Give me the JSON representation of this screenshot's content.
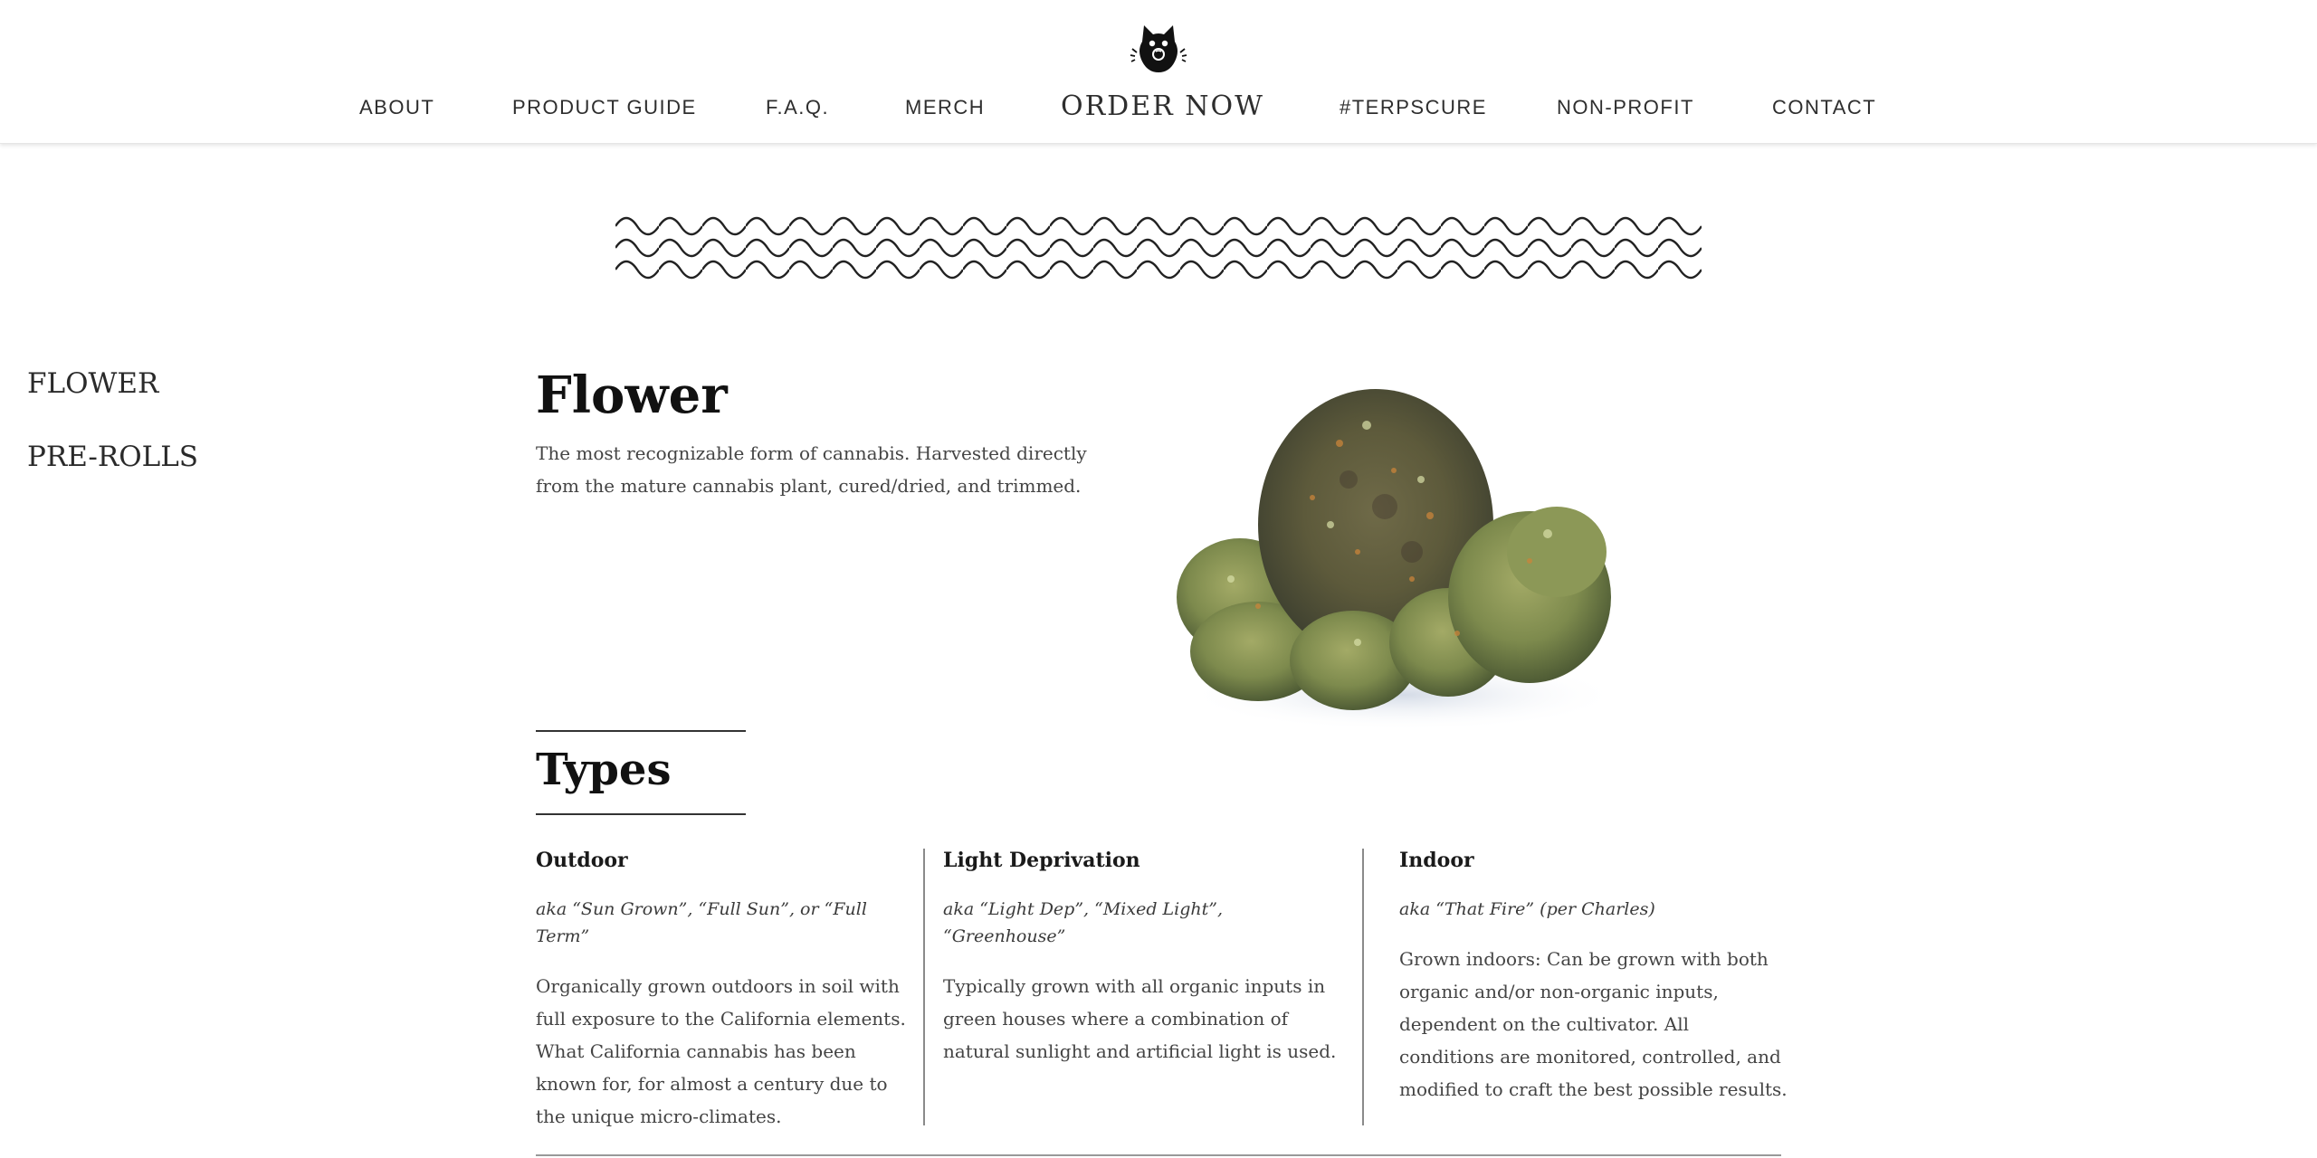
{
  "nav": {
    "about": "ABOUT",
    "product_guide": "PRODUCT GUIDE",
    "faq": "F.A.Q.",
    "merch": "MERCH",
    "order_now": "ORDER NOW",
    "terpscure": "#TERPSCURE",
    "non_profit": "NON-PROFIT",
    "contact": "CONTACT"
  },
  "sidebar": {
    "items": [
      {
        "label": "FLOWER"
      },
      {
        "label": "PRE-ROLLS"
      }
    ]
  },
  "main": {
    "title": "Flower",
    "intro": "The most recognizable form of cannabis. Harvested directly from the mature cannabis plant, cured/dried, and trimmed.",
    "types_heading": "Types",
    "types": [
      {
        "title": "Outdoor",
        "aka": "aka “Sun Grown”, “Full Sun”, or “Full Term”",
        "body": "Organically grown outdoors in soil with full exposure to the California elements. What California cannabis has been known for, for almost a century due to the unique micro-climates."
      },
      {
        "title": "Light Deprivation",
        "aka": "aka “Light Dep”, “Mixed Light”, “Greenhouse”",
        "body": "Typically grown with all organic inputs in green houses where a combination of natural sunlight and artificial light is used."
      },
      {
        "title": "Indoor",
        "aka": "aka “That Fire” (per Charles)",
        "body": "Grown indoors: Can be grown with both organic and/or non-organic inputs, dependent on the cultivator. All conditions are monitored, controlled, and modified to craft the best possible results."
      }
    ]
  },
  "icons": {
    "logo": "cat-logo-icon",
    "divider": "wave-divider"
  }
}
